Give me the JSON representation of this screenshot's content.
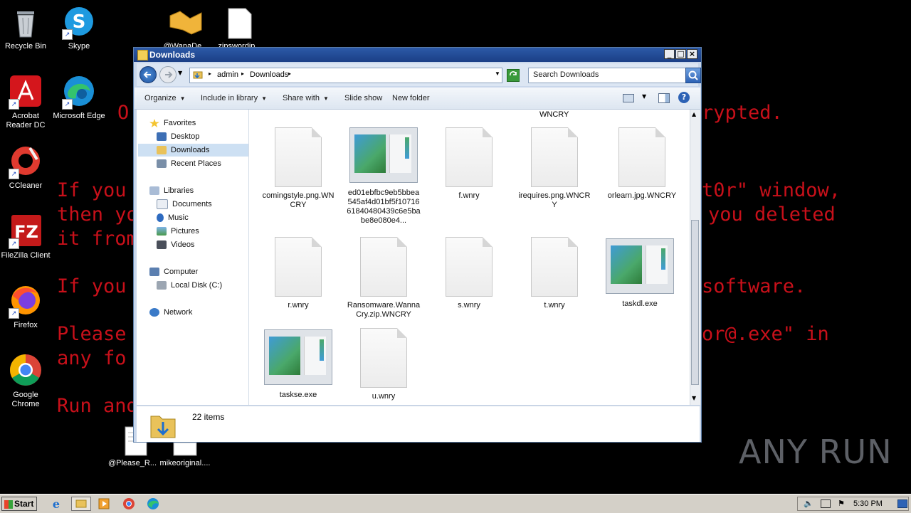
{
  "wallpaper": {
    "line_encrypted_left": "O",
    "line_encrypted_right": "rypted.",
    "line_if1_left": "If you",
    "line_if1_right": "t0r\" window,",
    "line_then_left": "then yo",
    "line_then_right": "you deleted",
    "line_it_left": "it from",
    "line_if2_left": "If you",
    "line_if2_right": "software.",
    "line_please_left": "Please",
    "line_please_right": "or@.exe\" in",
    "line_any_left": "any fo",
    "line_run_left": "Run and"
  },
  "desktop": {
    "icons": [
      {
        "label": "Recycle Bin"
      },
      {
        "label": "Skype"
      },
      {
        "label": "Acrobat Reader DC"
      },
      {
        "label": "Microsoft Edge"
      },
      {
        "label": "CCleaner"
      },
      {
        "label": "FileZilla Client"
      },
      {
        "label": "Firefox"
      },
      {
        "label": "Google Chrome"
      },
      {
        "label": "@WanaDe..."
      },
      {
        "label": "zipswordip..."
      },
      {
        "label": "@Please_R..."
      },
      {
        "label": "mikeoriginal...."
      }
    ]
  },
  "window": {
    "title": "Downloads",
    "breadcrumb": [
      "admin",
      "Downloads"
    ],
    "search_placeholder": "Search Downloads",
    "toolbar": {
      "organize": "Organize",
      "include_in_library": "Include in library",
      "share_with": "Share with",
      "slide_show": "Slide show",
      "new_folder": "New folder"
    },
    "nav": {
      "favorites": "Favorites",
      "desktop": "Desktop",
      "downloads": "Downloads",
      "recent_places": "Recent Places",
      "libraries": "Libraries",
      "documents": "Documents",
      "music": "Music",
      "pictures": "Pictures",
      "videos": "Videos",
      "computer": "Computer",
      "local_disk": "Local Disk (C:)",
      "network": "Network"
    },
    "partial_top_label": "WNCRY",
    "files": [
      {
        "name": "comingstyle.png.WNCRY",
        "type": "doc"
      },
      {
        "name": "ed01ebfbc9eb5bbea545af4d01bf5f1071661840480439c6e5babe8e080e4...",
        "type": "exe"
      },
      {
        "name": "f.wnry",
        "type": "doc"
      },
      {
        "name": "irequires.png.WNCRY",
        "type": "doc"
      },
      {
        "name": "orlearn.jpg.WNCRY",
        "type": "doc"
      },
      {
        "name": "r.wnry",
        "type": "doc"
      },
      {
        "name": "Ransomware.WannaCry.zip.WNCRY",
        "type": "doc"
      },
      {
        "name": "s.wnry",
        "type": "doc"
      },
      {
        "name": "t.wnry",
        "type": "doc"
      },
      {
        "name": "taskdl.exe",
        "type": "exe"
      },
      {
        "name": "taskse.exe",
        "type": "exe"
      },
      {
        "name": "u.wnry",
        "type": "doc"
      }
    ],
    "status": {
      "item_count": "22 items"
    }
  },
  "taskbar": {
    "start": "Start",
    "clock": "5:30 PM"
  },
  "watermark": "ANY RUN"
}
